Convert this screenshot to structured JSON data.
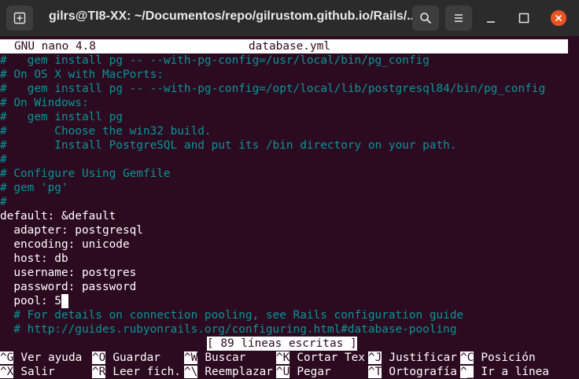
{
  "window": {
    "title": "gilrs@TI8-XX: ~/Documentos/repo/gilrustom.github.io/Rails/..."
  },
  "nano": {
    "version": "GNU nano 4.8",
    "filename": "database.yml",
    "lines": [
      {
        "text": "#   gem install pg -- --with-pg-config=/usr/local/bin/pg_config",
        "kind": "comment"
      },
      {
        "text": "# On OS X with MacPorts:",
        "kind": "comment"
      },
      {
        "text": "#   gem install pg -- --with-pg-config=/opt/local/lib/postgresql84/bin/pg_config",
        "kind": "comment"
      },
      {
        "text": "# On Windows:",
        "kind": "comment"
      },
      {
        "text": "#   gem install pg",
        "kind": "comment"
      },
      {
        "text": "#       Choose the win32 build.",
        "kind": "comment"
      },
      {
        "text": "#       Install PostgreSQL and put its /bin directory on your path.",
        "kind": "comment"
      },
      {
        "text": "#",
        "kind": "comment"
      },
      {
        "text": "# Configure Using Gemfile",
        "kind": "comment"
      },
      {
        "text": "# gem 'pg'",
        "kind": "comment"
      },
      {
        "text": "#",
        "kind": "comment"
      },
      {
        "text": "default: &default",
        "kind": "code"
      },
      {
        "text": "  adapter: postgresql",
        "kind": "code"
      },
      {
        "text": "  encoding: unicode",
        "kind": "code"
      },
      {
        "text": "  host: db",
        "kind": "code"
      },
      {
        "text": "  username: postgres",
        "kind": "code"
      },
      {
        "text": "  password: password",
        "kind": "code"
      },
      {
        "text": "  pool: 5",
        "kind": "code"
      },
      {
        "text": "  # For details on connection pooling, see Rails configuration guide",
        "kind": "comment"
      },
      {
        "text": "  # http://guides.rubyonrails.org/configuring.html#database-pooling",
        "kind": "comment"
      }
    ],
    "status": "[ 89 líneas escritas ]",
    "shortcuts_row1": [
      {
        "key": "^G",
        "label": "Ver ayuda"
      },
      {
        "key": "^O",
        "label": "Guardar"
      },
      {
        "key": "^W",
        "label": "Buscar"
      },
      {
        "key": "^K",
        "label": "Cortar Tex"
      },
      {
        "key": "^J",
        "label": "Justificar"
      },
      {
        "key": "^C",
        "label": "Posición"
      }
    ],
    "shortcuts_row2": [
      {
        "key": "^X",
        "label": "Salir"
      },
      {
        "key": "^R",
        "label": "Leer fich."
      },
      {
        "key": "^\\",
        "label": "Reemplazar"
      },
      {
        "key": "^U",
        "label": "Pegar"
      },
      {
        "key": "^T",
        "label": "Ortografía"
      },
      {
        "key": "^_",
        "label": "Ir a línea"
      }
    ]
  },
  "colors": {
    "background": "#2c0a1f",
    "comment": "#06989a",
    "text": "#ffffff",
    "titlebar": "#2b2b2b",
    "close": "#e95420"
  }
}
